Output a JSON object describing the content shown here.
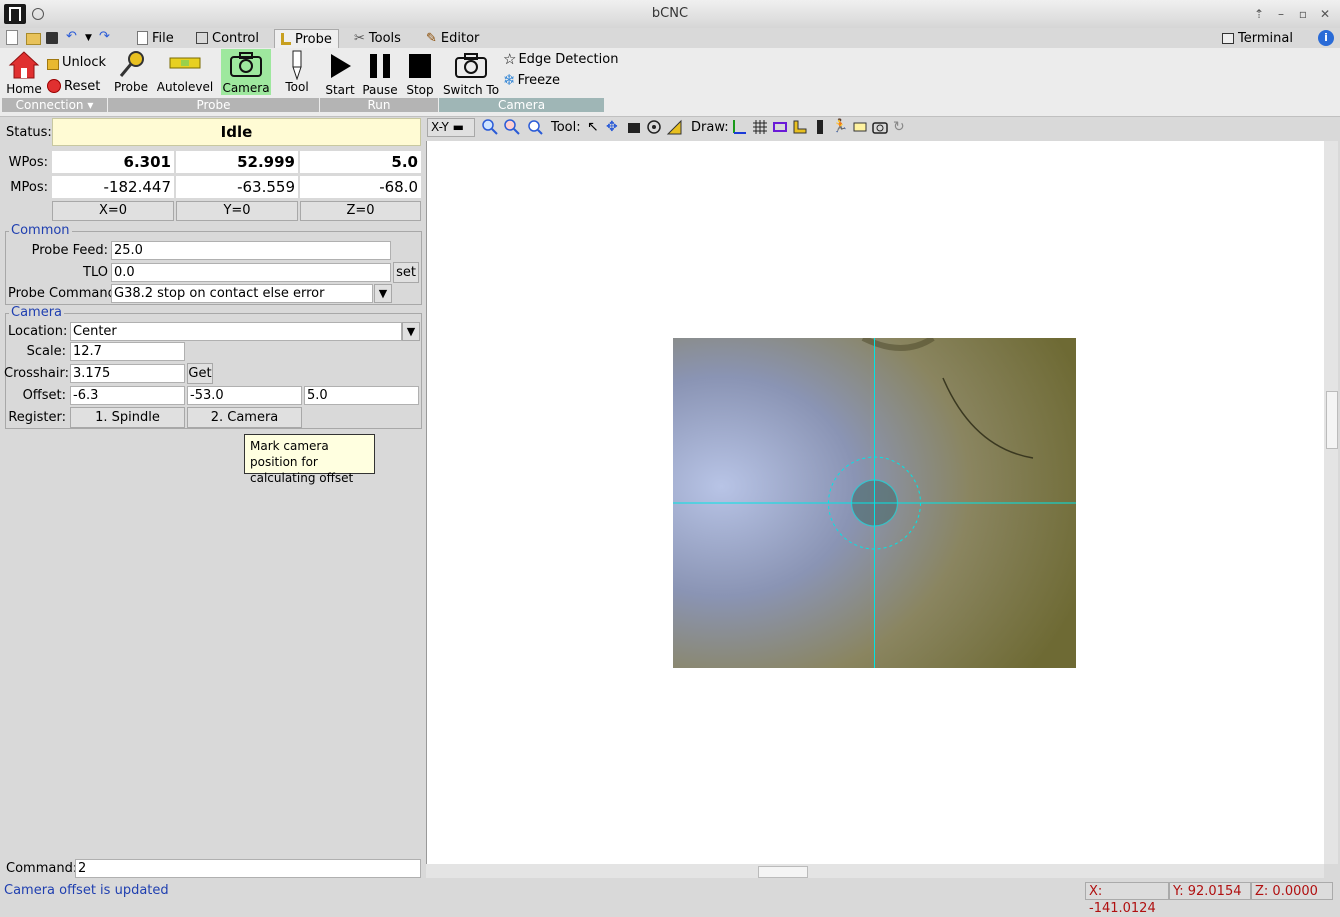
{
  "window": {
    "title": "bCNC"
  },
  "menu": {
    "tabs": [
      {
        "label": "File"
      },
      {
        "label": "Control"
      },
      {
        "label": "Probe"
      },
      {
        "label": "Tools"
      },
      {
        "label": "Editor"
      }
    ],
    "active_tab": "Probe",
    "terminal_label": "Terminal"
  },
  "ribbon": {
    "connection": {
      "home": "Home",
      "unlock": "Unlock",
      "reset": "Reset",
      "group": "Connection"
    },
    "probe": {
      "probe": "Probe",
      "autolevel": "Autolevel",
      "camera": "Camera",
      "tool": "Tool",
      "group": "Probe"
    },
    "run": {
      "start": "Start",
      "pause": "Pause",
      "stop": "Stop",
      "group": "Run"
    },
    "camera": {
      "switch_to": "Switch To",
      "edge_detection": "Edge Detection",
      "freeze": "Freeze",
      "group": "Camera"
    }
  },
  "status": {
    "label": "Status:",
    "state": "Idle",
    "wpos_label": "WPos:",
    "wpos": {
      "x": "6.301",
      "y": "52.999",
      "z": "5.0"
    },
    "mpos_label": "MPos:",
    "mpos": {
      "x": "-182.447",
      "y": "-63.559",
      "z": "-68.0"
    },
    "zero_buttons": {
      "x": "X=0",
      "y": "Y=0",
      "z": "Z=0"
    }
  },
  "common": {
    "legend": "Common",
    "probe_feed_label": "Probe Feed:",
    "probe_feed": "25.0",
    "tlo_label": "TLO",
    "tlo": "0.0",
    "set_button": "set",
    "probe_command_label": "Probe Command",
    "probe_command": "G38.2 stop on contact else error"
  },
  "camera_panel": {
    "legend": "Camera",
    "location_label": "Location:",
    "location": "Center",
    "scale_label": "Scale:",
    "scale": "12.7",
    "crosshair_label": "Crosshair:",
    "crosshair": "3.175",
    "get_button": "Get",
    "offset_label": "Offset:",
    "offset": {
      "x": "-6.3",
      "y": "-53.0",
      "z": "5.0"
    },
    "register_label": "Register:",
    "register_spindle": "1. Spindle",
    "register_camera": "2. Camera",
    "tooltip": "Mark camera position for calculating offset"
  },
  "canvas_toolbar": {
    "view": "X-Y",
    "tool_label": "Tool:",
    "draw_label": "Draw:"
  },
  "command": {
    "label": "Command:",
    "value": "2"
  },
  "statusbar": {
    "message": "Camera offset is updated",
    "x": "X: -141.0124",
    "y": "Y: 92.0154",
    "z": "Z: 0.0000"
  },
  "colors": {
    "accent_blue": "#1f3fb0",
    "status_bg": "#fffbd4",
    "crosshair": "#00e5e5",
    "camera_active": "#9ee89e"
  }
}
